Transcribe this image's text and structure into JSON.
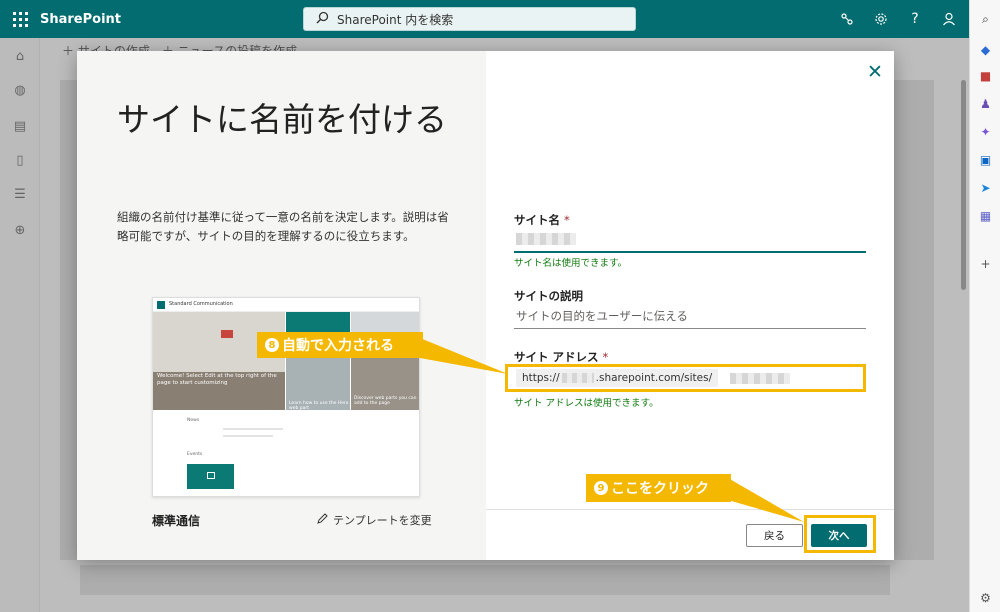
{
  "suite": {
    "brand": "SharePoint",
    "search_placeholder": "SharePoint 内を検索"
  },
  "background": {
    "command_create_site": "サイトの作成",
    "command_create_news": "ニュースの投稿を作成"
  },
  "dialog": {
    "title": "サイトに名前を付ける",
    "description": "組織の名前付け基準に従って一意の名前を決定します。説明は省略可能ですが、サイトの目的を理解するのに役立ちます。",
    "template": {
      "name": "標準通信",
      "change_label": "テンプレートを変更",
      "preview_site_name": "Standard Communication",
      "preview_hero_text": "Welcome! Select Edit at the top right of the page to start customizing",
      "preview_caption_2": "Learn how to use the Hero web part",
      "preview_caption_3": "Discover web parts you can add to the page",
      "preview_news": "News",
      "preview_events": "Events"
    },
    "fields": {
      "site_name_label": "サイト名",
      "site_name_status": "サイト名は使用できます。",
      "site_desc_label": "サイトの説明",
      "site_desc_placeholder": "サイトの目的をユーザーに伝える",
      "site_address_label": "サイト アドレス",
      "site_address_prefix_start": "https://",
      "site_address_prefix_end": ".sharepoint.com/sites/",
      "site_address_status": "サイト アドレスは使用できます。",
      "required_mark": "*"
    },
    "buttons": {
      "back": "戻る",
      "next": "次へ"
    }
  },
  "callouts": {
    "auto_fill": {
      "num": "8",
      "text": "自動で入力される"
    },
    "click_here": {
      "num": "9",
      "text": "ここをクリック"
    }
  },
  "colors": {
    "brand_teal": "#036c70",
    "callout_yellow": "#f5b800",
    "ok_green": "#107c10"
  }
}
